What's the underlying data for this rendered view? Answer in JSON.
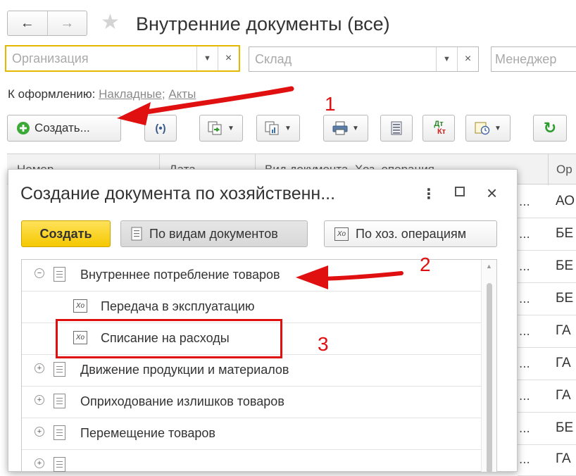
{
  "header": {
    "title": "Внутренние документы (все)",
    "back_symbol": "🡐",
    "forward_symbol": "🡒",
    "favorite_icon": "star-icon"
  },
  "filters": {
    "organization_placeholder": "Организация",
    "warehouse_placeholder": "Склад",
    "manager_placeholder": "Менеджер"
  },
  "links": {
    "label": "К оформлению:",
    "items": [
      "Накладные",
      "Акты"
    ],
    "separator": ";"
  },
  "toolbar": {
    "create_label": "Создать...",
    "dt_label": "Дт",
    "kt_label": "Кт"
  },
  "list": {
    "columns": [
      "Номер",
      "Дата",
      "Вид документа, Хоз. операция",
      "Ор"
    ],
    "rows": [
      {
        "org": "АО"
      },
      {
        "org": "БЕ"
      },
      {
        "org": "БЕ"
      },
      {
        "org": "БЕ"
      },
      {
        "org": "ГА"
      },
      {
        "org": "ГА"
      },
      {
        "org": "ГА"
      },
      {
        "org": "БЕ"
      },
      {
        "org": "ГА"
      }
    ],
    "row_overflow": "..."
  },
  "dialog": {
    "title": "Создание документа по хозяйственн...",
    "create_button": "Создать",
    "by_doc_types": "По видам документов",
    "by_operations": "По хоз. операциям",
    "xo_glyph": "Xo",
    "tree": [
      {
        "label": "Внутреннее потребление товаров",
        "level": 0,
        "expanded": true
      },
      {
        "label": "Передача в эксплуатацию",
        "level": 1
      },
      {
        "label": "Списание на расходы",
        "level": 1
      },
      {
        "label": "Движение продукции и материалов",
        "level": 0,
        "expanded": false
      },
      {
        "label": "Оприходование излишков товаров",
        "level": 0,
        "expanded": false
      },
      {
        "label": "Перемещение товаров",
        "level": 0,
        "expanded": false
      }
    ]
  },
  "annotations": {
    "step1": "1",
    "step2": "2",
    "step3": "3",
    "color": "#e01010"
  },
  "colors": {
    "accent_yellow": "#f5c800",
    "focus_border": "#e5b800",
    "link_gray": "#8a8a8a"
  }
}
